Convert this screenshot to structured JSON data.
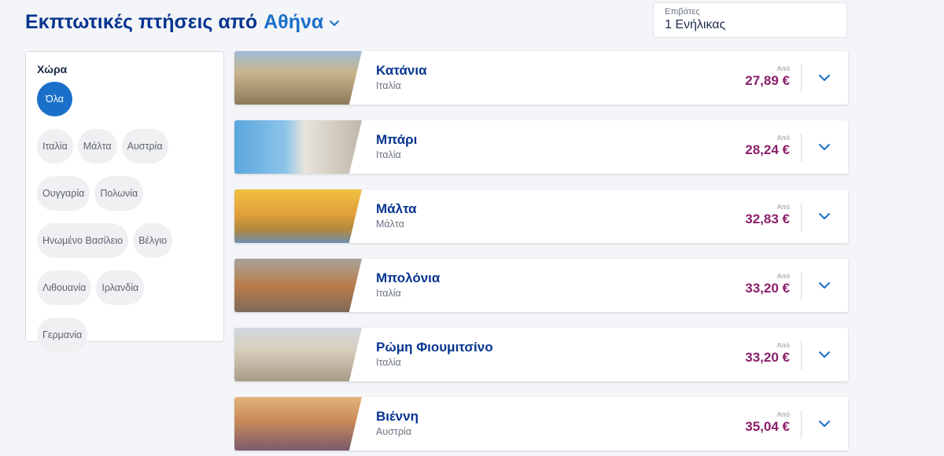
{
  "header": {
    "title_prefix": "Εκπτωτικές πτήσεις από",
    "origin": "Αθήνα"
  },
  "passengers": {
    "label": "Επιβάτες",
    "value": "1 Ενήλικας"
  },
  "filter": {
    "title": "Χώρα",
    "chips": [
      "Όλα",
      "Ιταλία",
      "Μάλτα",
      "Αυστρία",
      "Ουγγαρία",
      "Πολωνία",
      "Ηνωμένο Βασίλειο",
      "Βέλγιο",
      "Λιθουανία",
      "Ιρλανδία",
      "Γερμανία"
    ],
    "selected": "Όλα"
  },
  "flights": [
    {
      "city": "Κατάνια",
      "country": "Ιταλία",
      "from_label": "Από",
      "price": "27,89 €"
    },
    {
      "city": "Μπάρι",
      "country": "Ιταλία",
      "from_label": "Από",
      "price": "28,24 €"
    },
    {
      "city": "Μάλτα",
      "country": "Μάλτα",
      "from_label": "Από",
      "price": "32,83 €"
    },
    {
      "city": "Μπολόνια",
      "country": "Ιταλία",
      "from_label": "Από",
      "price": "33,20 €"
    },
    {
      "city": "Ρώμη Φιουμιτσίνο",
      "country": "Ιταλία",
      "from_label": "Από",
      "price": "33,20 €"
    },
    {
      "city": "Βιέννη",
      "country": "Αυστρία",
      "from_label": "Από",
      "price": "35,04 €"
    }
  ],
  "colors": {
    "brand": "#073590",
    "accent": "#1a6fc9",
    "price": "#8a1f6a"
  }
}
